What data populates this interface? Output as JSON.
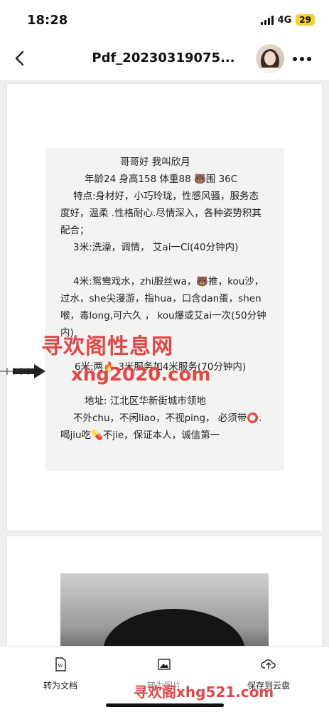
{
  "status": {
    "time": "18:28",
    "network": "4G",
    "battery": "29"
  },
  "nav": {
    "title": "Pdf_20230319075...",
    "back_icon": "chevron-left-icon",
    "more_icon": "more-horizontal-icon"
  },
  "document": {
    "lines": [
      "哥哥好       我叫欣月",
      "年龄24 身高158 体重88 🐻围 36C",
      "特点:身材好，小巧玲珑，性感风骚，服务态",
      "度好，温柔 .性格耐心.尽情深入，各种姿势积其",
      "配合；",
      "3米:洗澡，调情，   艾ai一Ci(40分钟内)",
      "4米:鸳鸯戏水，zhi服丝wa，🐻推，kou沙，",
      "过水，she尖漫游，指hua，口含dan蛋，shen",
      "喉，毒long,可六久 ，  kou爆或艾ai一次(50分钟",
      "内)",
      "6米:两🔥 3米服务加4米服务(70分钟内)",
      "地址: 江北区华新街城市领地",
      "不外chu，不闲liao，不视ping，  必须带⭕.",
      "喝jiu吃💊不jie，保证本人，诚信第一"
    ],
    "watermark_top": "寻欢阁性息网",
    "watermark_mid": "xhg2020.com"
  },
  "toolbar": {
    "convert_label": "转为文档",
    "image_label": "转为图片",
    "save_label": "保存到云盘",
    "watermark_bottom": "寻欢阁xhg521.com"
  },
  "colors": {
    "watermark": "#e64545",
    "battery": "#f3d22f"
  }
}
